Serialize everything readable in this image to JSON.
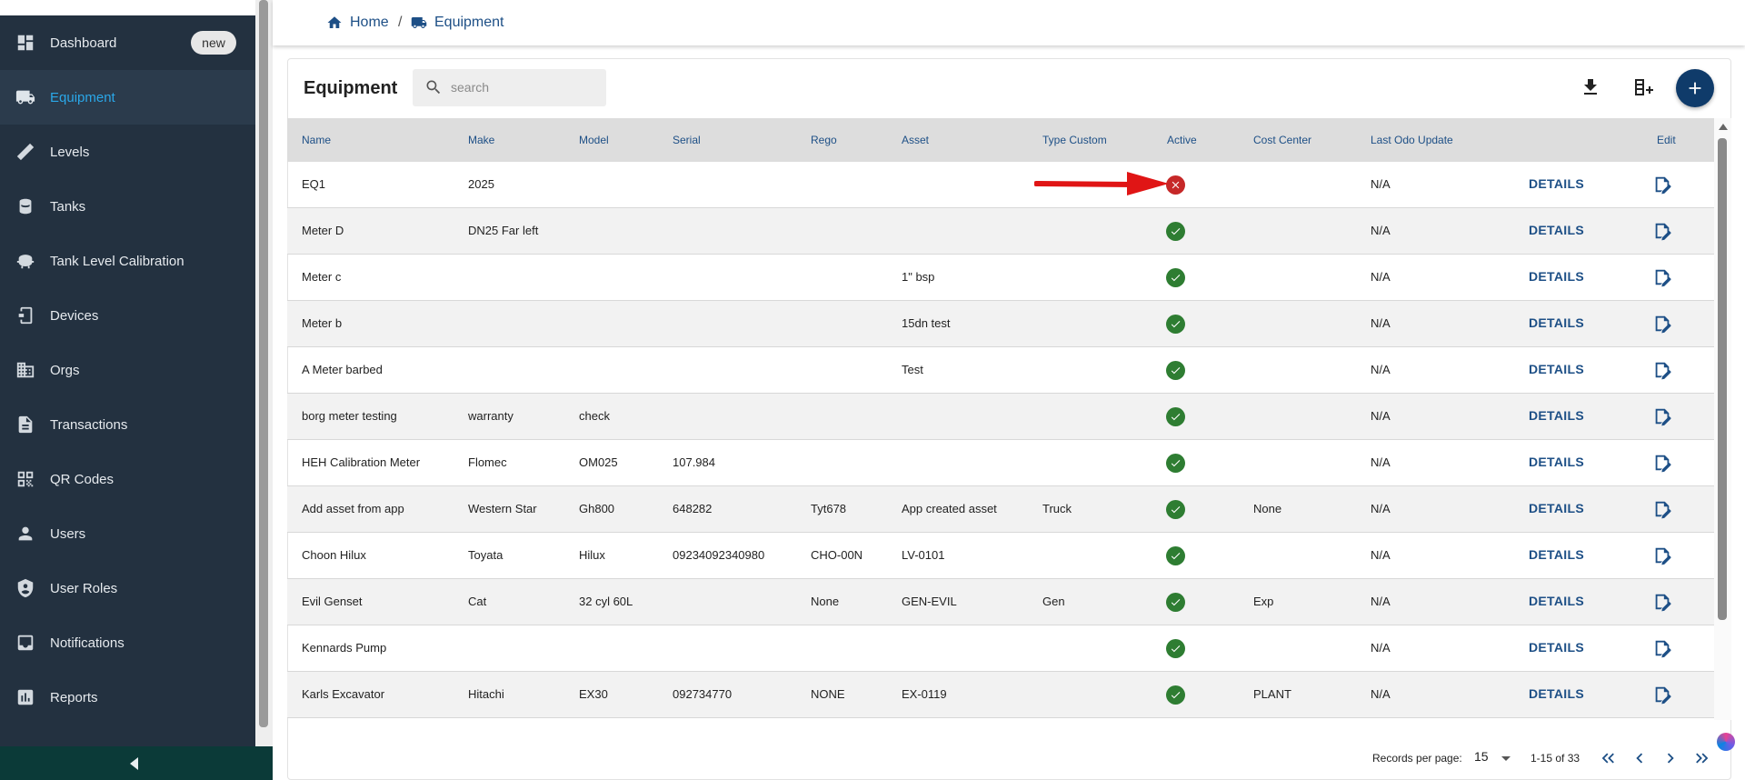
{
  "sidebar": {
    "items": [
      {
        "label": "Dashboard",
        "icon": "dashboard-icon",
        "badge": "new"
      },
      {
        "label": "Equipment",
        "icon": "truck-icon",
        "active": true
      },
      {
        "label": "Levels",
        "icon": "ruler-icon"
      },
      {
        "label": "Tanks",
        "icon": "tank-icon"
      },
      {
        "label": "Tank Level Calibration",
        "icon": "calibration-icon"
      },
      {
        "label": "Devices",
        "icon": "device-icon"
      },
      {
        "label": "Orgs",
        "icon": "building-icon"
      },
      {
        "label": "Transactions",
        "icon": "document-icon"
      },
      {
        "label": "QR Codes",
        "icon": "qr-code-icon"
      },
      {
        "label": "Users",
        "icon": "user-icon"
      },
      {
        "label": "User Roles",
        "icon": "shield-icon"
      },
      {
        "label": "Notifications",
        "icon": "inbox-icon"
      },
      {
        "label": "Reports",
        "icon": "bar-chart-icon"
      }
    ],
    "collapse_icon": "chevron-left-icon"
  },
  "breadcrumb": {
    "home": "Home",
    "separator": "/",
    "current": "Equipment"
  },
  "page": {
    "title": "Equipment",
    "search_placeholder": "search",
    "search_value": ""
  },
  "table": {
    "columns": [
      "Name",
      "Make",
      "Model",
      "Serial",
      "Rego",
      "Asset",
      "Type Custom",
      "Active",
      "Cost Center",
      "Last Odo Update",
      "Edit"
    ],
    "rows": [
      {
        "name": "EQ1",
        "make": "2025",
        "model": "",
        "serial": "",
        "rego": "",
        "asset": "",
        "type_custom": "",
        "active": false,
        "cost_center": "",
        "last_odo": "N/A",
        "details": "DETAILS"
      },
      {
        "name": "Meter D",
        "make": "DN25 Far left",
        "model": "",
        "serial": "",
        "rego": "",
        "asset": "",
        "type_custom": "",
        "active": true,
        "cost_center": "",
        "last_odo": "N/A",
        "details": "DETAILS"
      },
      {
        "name": "Meter c",
        "make": "",
        "model": "",
        "serial": "",
        "rego": "",
        "asset": "1\" bsp",
        "type_custom": "",
        "active": true,
        "cost_center": "",
        "last_odo": "N/A",
        "details": "DETAILS"
      },
      {
        "name": "Meter b",
        "make": "",
        "model": "",
        "serial": "",
        "rego": "",
        "asset": "15dn test",
        "type_custom": "",
        "active": true,
        "cost_center": "",
        "last_odo": "N/A",
        "details": "DETAILS"
      },
      {
        "name": "A Meter barbed",
        "make": "",
        "model": "",
        "serial": "",
        "rego": "",
        "asset": "Test",
        "type_custom": "",
        "active": true,
        "cost_center": "",
        "last_odo": "N/A",
        "details": "DETAILS"
      },
      {
        "name": "borg meter testing",
        "make": "warranty",
        "model": "check",
        "serial": "",
        "rego": "",
        "asset": "",
        "type_custom": "",
        "active": true,
        "cost_center": "",
        "last_odo": "N/A",
        "details": "DETAILS"
      },
      {
        "name": "HEH Calibration Meter",
        "make": "Flomec",
        "model": "OM025",
        "serial": "107.984",
        "rego": "",
        "asset": "",
        "type_custom": "",
        "active": true,
        "cost_center": "",
        "last_odo": "N/A",
        "details": "DETAILS"
      },
      {
        "name": "Add asset from app",
        "make": "Western Star",
        "model": "Gh800",
        "serial": "648282",
        "rego": "Tyt678",
        "asset": "App created asset",
        "type_custom": "Truck",
        "active": true,
        "cost_center": "None",
        "last_odo": "N/A",
        "details": "DETAILS"
      },
      {
        "name": "Choon Hilux",
        "make": "Toyata",
        "model": "Hilux",
        "serial": "09234092340980",
        "rego": "CHO-00N",
        "asset": "LV-0101",
        "type_custom": "",
        "active": true,
        "cost_center": "",
        "last_odo": "N/A",
        "details": "DETAILS"
      },
      {
        "name": "Evil Genset",
        "make": "Cat",
        "model": "32 cyl 60L",
        "serial": "",
        "rego": "None",
        "asset": "GEN-EVIL",
        "type_custom": "Gen",
        "active": true,
        "cost_center": "Exp",
        "last_odo": "N/A",
        "details": "DETAILS"
      },
      {
        "name": "Kennards Pump",
        "make": "",
        "model": "",
        "serial": "",
        "rego": "",
        "asset": "",
        "type_custom": "",
        "active": true,
        "cost_center": "",
        "last_odo": "N/A",
        "details": "DETAILS"
      },
      {
        "name": "Karls Excavator",
        "make": "Hitachi",
        "model": "EX30",
        "serial": "092734770",
        "rego": "NONE",
        "asset": "EX-0119",
        "type_custom": "",
        "active": true,
        "cost_center": "PLANT",
        "last_odo": "N/A",
        "details": "DETAILS"
      },
      {
        "name": "",
        "make": "",
        "model": "",
        "serial": "",
        "rego": "",
        "asset": "",
        "type_custom": "",
        "active": true,
        "cost_center": "",
        "last_odo": "",
        "details": ""
      }
    ]
  },
  "pagination": {
    "label": "Records per page:",
    "per_page": "15",
    "range": "1-15 of 33"
  },
  "colors": {
    "sidebar_bg": "#233140",
    "accent": "#1d4f86",
    "active_nav": "#2aa7e8",
    "ok": "#2e7d32",
    "bad": "#c62828",
    "annotation_arrow": "#e01515"
  }
}
